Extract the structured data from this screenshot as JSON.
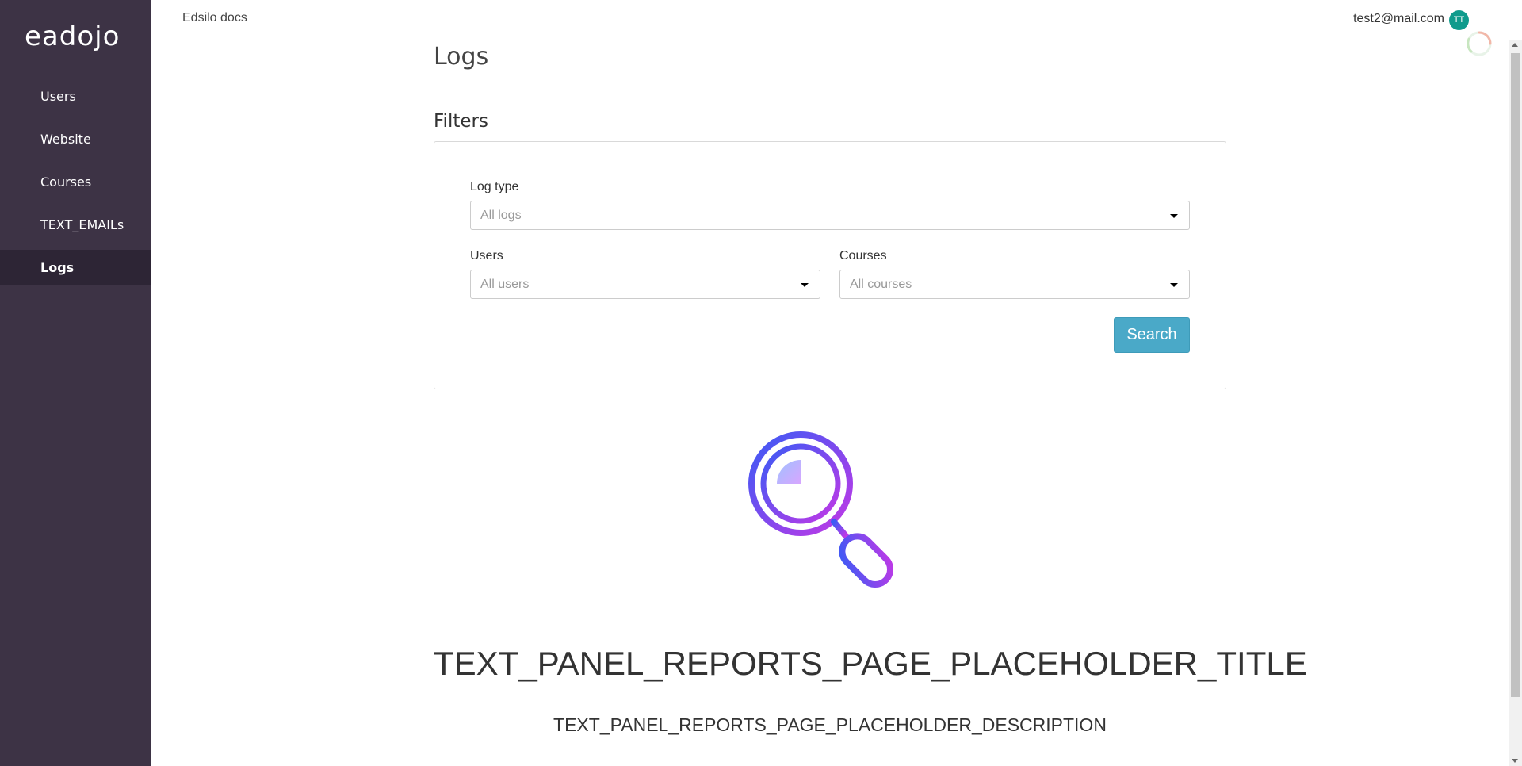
{
  "sidebar": {
    "logo": "eadojo",
    "items": [
      {
        "label": "Users"
      },
      {
        "label": "Website"
      },
      {
        "label": "Courses"
      },
      {
        "label": "TEXT_EMAILs"
      },
      {
        "label": "Logs"
      }
    ],
    "active_index": 4
  },
  "header": {
    "brand": "Edsilo docs",
    "user_email": "test2@mail.com",
    "avatar_initials": "TT"
  },
  "main": {
    "page_title": "Logs",
    "filters_title": "Filters",
    "filters": {
      "log_type": {
        "label": "Log type",
        "placeholder": "All logs"
      },
      "users": {
        "label": "Users",
        "placeholder": "All users"
      },
      "courses": {
        "label": "Courses",
        "placeholder": "All courses"
      }
    },
    "search_button": "Search",
    "placeholder": {
      "title": "TEXT_PANEL_REPORTS_PAGE_PLACEHOLDER_TITLE",
      "description": "TEXT_PANEL_REPORTS_PAGE_PLACEHOLDER_DESCRIPTION",
      "icon": "magnifier-icon"
    }
  },
  "colors": {
    "sidebar_bg": "#3d3345",
    "sidebar_active_bg": "#2d2535",
    "accent": "#4aa9c8",
    "avatar_bg": "#0f9b8c",
    "magnifier_gradient_start": "#3b5bf5",
    "magnifier_gradient_end": "#c238e6"
  }
}
